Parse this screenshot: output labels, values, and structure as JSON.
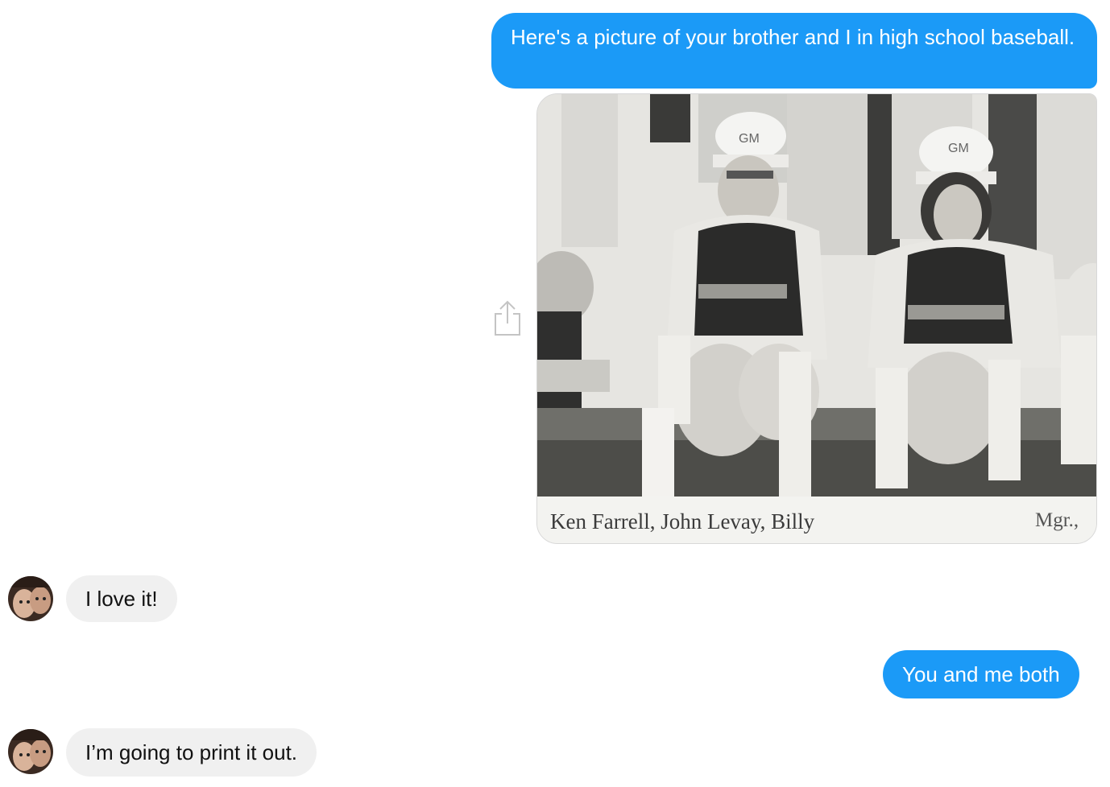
{
  "messages": {
    "m1": {
      "sender": "me",
      "text": "Here's a picture of your brother and I in high school baseball."
    },
    "photo": {
      "caption_left": "Ken Farrell, John Levay, Billy",
      "caption_right": "Mgr.,",
      "cap_letters_1": "GM",
      "cap_letters_2": "GM",
      "share_icon": "share-icon"
    },
    "m2": {
      "sender": "them",
      "text": "I love it!"
    },
    "m3": {
      "sender": "me",
      "text": "You and me both"
    },
    "m4": {
      "sender": "them",
      "text": "I’m going to print it out."
    }
  },
  "colors": {
    "outgoing_bubble": "#1b9af7",
    "incoming_bubble": "#f0f0f0",
    "outgoing_text": "#ffffff",
    "incoming_text": "#111111"
  }
}
